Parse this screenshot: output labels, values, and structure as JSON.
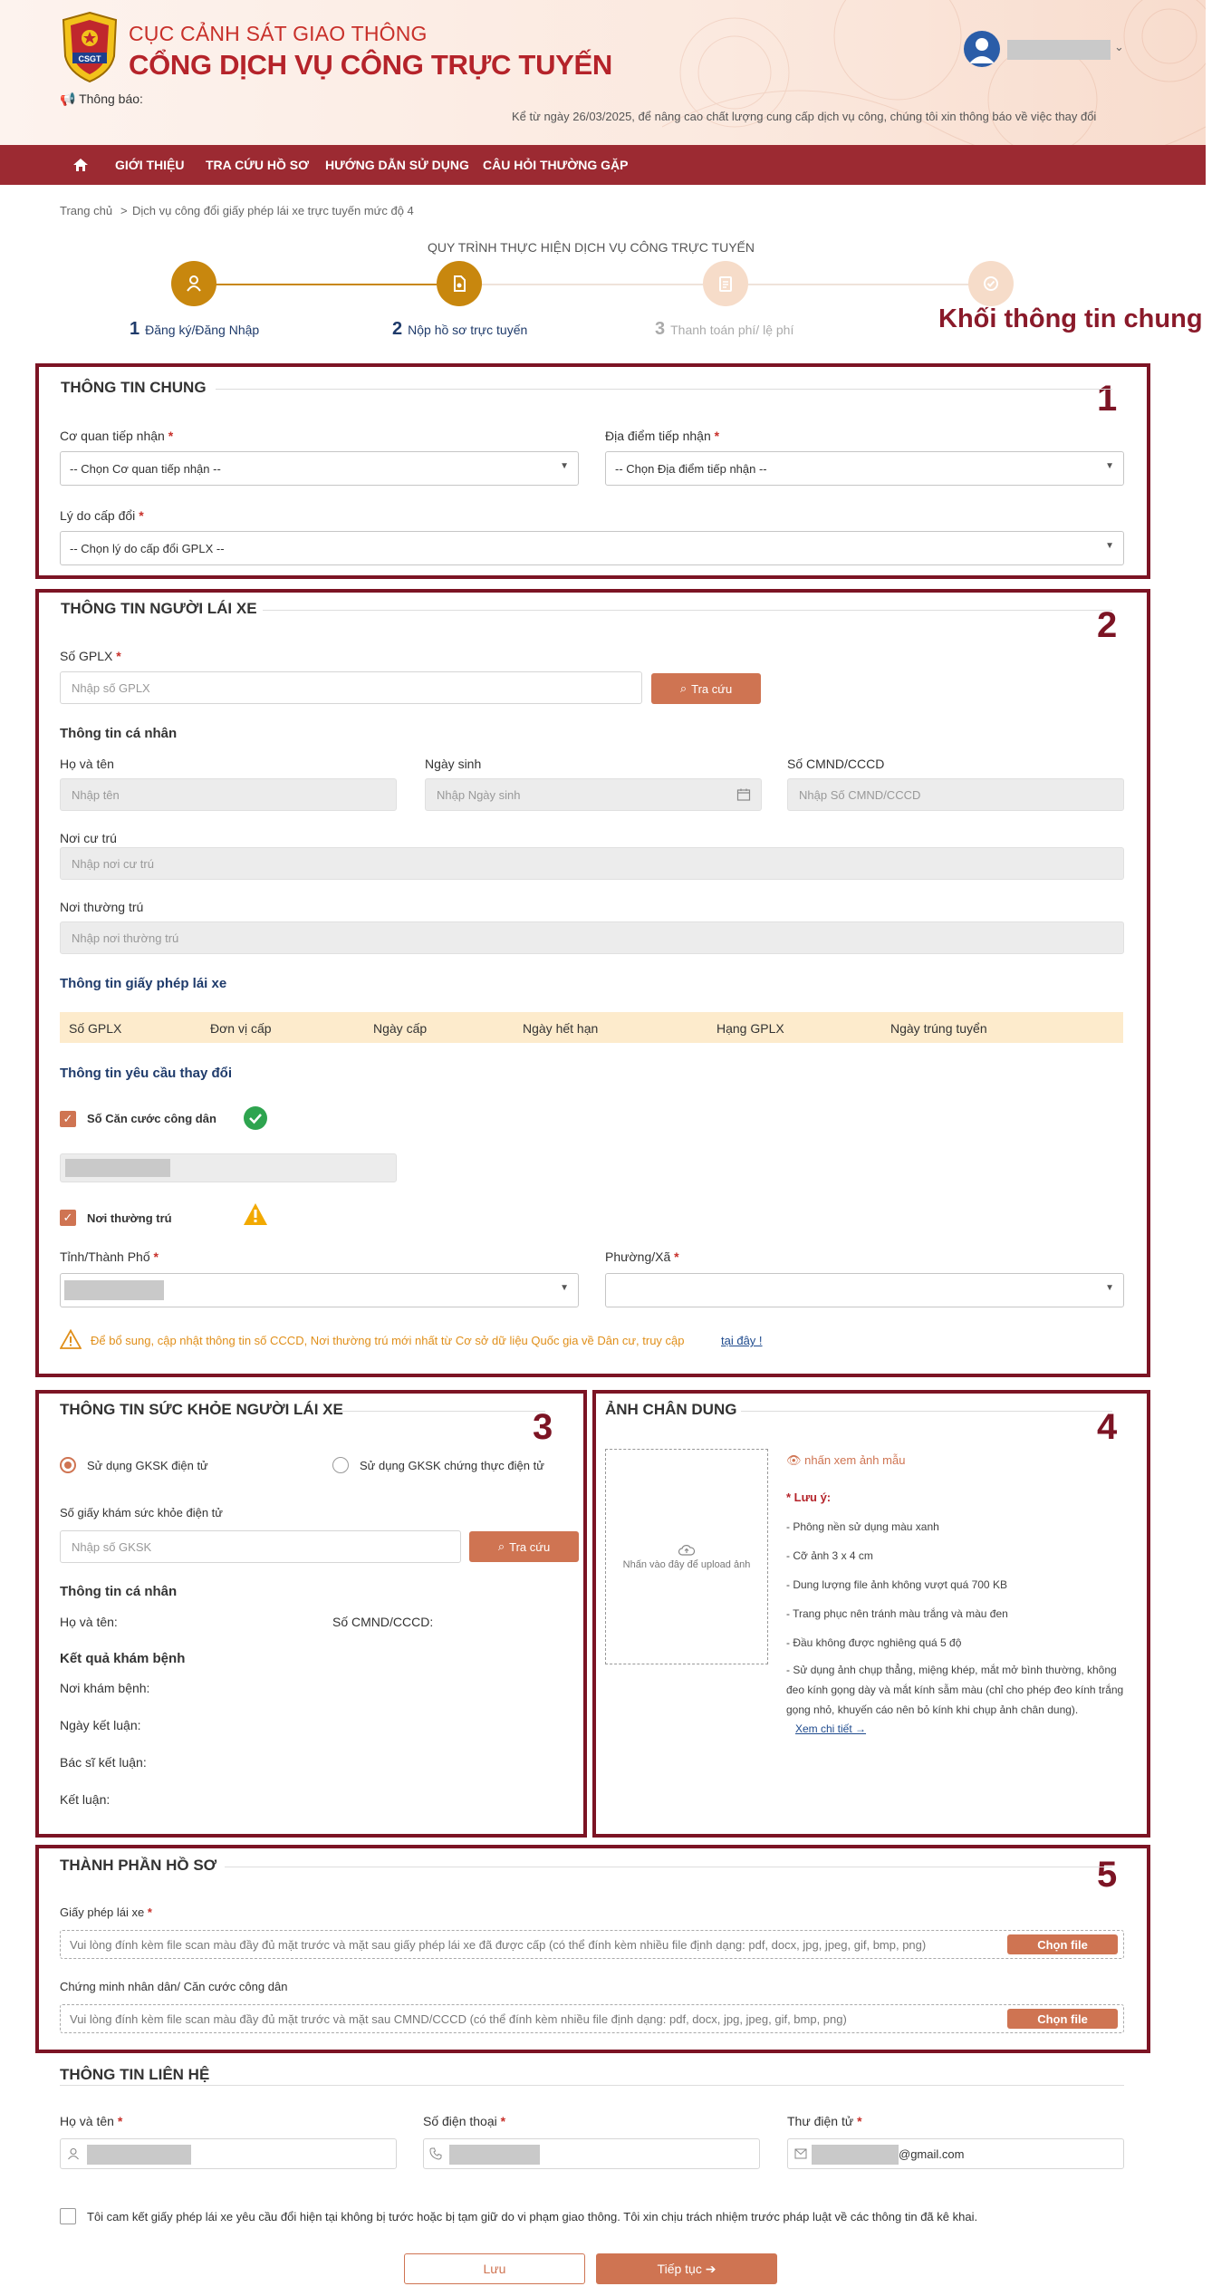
{
  "header": {
    "agency": "CỤC CẢNH SÁT GIAO THÔNG",
    "portal": "CỔNG DỊCH VỤ CÔNG TRỰC TUYẾN",
    "notice_label": "📢 Thông báo:",
    "notice_text": "Kể từ ngày 26/03/2025, để nâng cao chất lượng cung cấp dịch vụ công, chúng tôi xin thông báo về việc thay đổi",
    "logo_text": "CSGT",
    "user_caret": "⌄"
  },
  "nav": {
    "items": [
      "GIỚI THIỆU",
      "TRA CỨU HỒ SƠ",
      "HƯỚNG DẪN SỬ DỤNG",
      "CÂU HỎI THƯỜNG GẶP"
    ]
  },
  "breadcrumb": {
    "home": "Trang chủ",
    "sep": ">",
    "current": "Dịch vụ công đổi giấy phép lái xe trực tuyến mức độ 4"
  },
  "steps": {
    "title": "QUY TRÌNH THỰC HIỆN DỊCH VỤ CÔNG TRỰC TUYẾN",
    "items": [
      {
        "num": "1",
        "label": "Đăng ký/Đăng Nhập"
      },
      {
        "num": "2",
        "label": "Nộp hồ sơ trực tuyến"
      },
      {
        "num": "3",
        "label": "Thanh toán phí/ lệ phí"
      }
    ],
    "active_color": "#c8870e",
    "inactive_color": "#f6dcc9"
  },
  "annotations": {
    "title": "Khối thông tin chung",
    "n1": "1",
    "n2": "2",
    "n3": "3",
    "n4": "4",
    "n5": "5"
  },
  "general": {
    "title": "THÔNG TIN CHUNG",
    "agency_label": "Cơ quan tiếp nhận",
    "agency_value": "-- Chọn Cơ quan tiếp nhận --",
    "place_label": "Địa điểm tiếp nhận",
    "place_value": "-- Chọn Địa điểm tiếp nhận --",
    "reason_label": "Lý do cấp đổi",
    "reason_value": "-- Chọn lý do cấp đổi GPLX --",
    "star": "*"
  },
  "driver": {
    "title": "THÔNG TIN NGƯỜI LÁI XE",
    "gplx_label": "Số GPLX",
    "gplx_placeholder": "Nhập số GPLX",
    "lookup": "Tra cứu",
    "personal_title": "Thông tin cá nhân",
    "name_label": "Họ và tên",
    "name_placeholder": "Nhập tên",
    "dob_label": "Ngày sinh",
    "dob_placeholder": "Nhập Ngày sinh",
    "id_label": "Số CMND/CCCD",
    "id_placeholder": "Nhập Số CMND/CCCD",
    "residence_label": "Nơi cư trú",
    "residence_placeholder": "Nhập nơi cư trú",
    "permanent_label": "Nơi thường trú",
    "permanent_placeholder": "Nhập nơi thường trú",
    "license_title": "Thông tin giấy phép lái xe",
    "columns": [
      "Số GPLX",
      "Đơn vị cấp",
      "Ngày cấp",
      "Ngày hết hạn",
      "Hạng GPLX",
      "Ngày trúng tuyển"
    ],
    "change_title": "Thông tin yêu cầu thay đổi",
    "cccd_check": "Số Căn cước công dân",
    "permanent_check": "Nơi thường trú",
    "province_label": "Tỉnh/Thành Phố",
    "ward_label": "Phường/Xã",
    "warning_text": "Để bổ sung, cập nhật thông tin số CCCD, Nơi thường trú mới nhất từ Cơ sở dữ liệu Quốc gia về Dân cư, truy cập",
    "warning_link": "tại đây !"
  },
  "health": {
    "title": "THÔNG TIN SỨC KHỎE NGƯỜI LÁI XE",
    "opt1": "Sử dụng GKSK điện tử",
    "opt2": "Sử dụng GKSK chứng thực điện tử",
    "cert_label": "Số giấy khám sức khỏe điện tử",
    "cert_placeholder": "Nhập số GKSK",
    "lookup": "Tra cứu",
    "personal_title": "Thông tin cá nhân",
    "name": "Họ và tên:",
    "id": "Số CMND/CCCD:",
    "result_title": "Kết quả khám bệnh",
    "place": "Nơi khám bệnh:",
    "date": "Ngày kết luận:",
    "doctor": "Bác sĩ kết luận:",
    "conclusion": "Kết luận:"
  },
  "portrait": {
    "title": "ẢNH CHÂN DUNG",
    "upload_hint": "Nhấn vào đây để upload ảnh",
    "sample_link": "nhấn xem ảnh mẫu",
    "note_title": "* Lưu ý:",
    "notes": [
      "- Phông nền sử dụng màu xanh",
      "- Cỡ ảnh 3 x 4 cm",
      "- Dung lượng file ảnh không vượt quá 700 KB",
      "- Trang phục nên tránh màu trắng và màu đen",
      "- Đầu không được nghiêng quá 5 độ",
      "- Sử dụng ảnh chụp thẳng, miệng khép, mắt mở bình thường, không đeo kính gọng dày và mắt kính sẫm màu (chỉ cho phép đeo kính trắng gọng nhỏ, khuyến cáo nên bỏ kính khi chụp ảnh chân dung)."
    ],
    "detail_link": "Xem chi tiết →"
  },
  "documents": {
    "title": "THÀNH PHẦN HỒ SƠ",
    "license_label": "Giấy phép lái xe",
    "license_hint": "Vui lòng đính kèm file scan màu đầy đủ mặt trước và mặt sau giấy phép lái xe đã được cấp (có thể đính kèm nhiều file định dạng: pdf, docx, jpg, jpeg, gif, bmp, png)",
    "id_label": "Chứng minh nhân dân/ Căn cước công dân",
    "id_hint": "Vui lòng đính kèm file scan màu đầy đủ mặt trước và mặt sau CMND/CCCD (có thể đính kèm nhiều file định dạng: pdf, docx, jpg, jpeg, gif, bmp, png)",
    "choose_file": "Chọn file"
  },
  "contact": {
    "title": "THÔNG TIN LIÊN HỆ",
    "name_label": "Họ và tên",
    "phone_label": "Số điện thoại",
    "email_label": "Thư điện tử",
    "email_suffix": "@gmail.com"
  },
  "commit": {
    "text": "Tôi cam kết giấy phép lái xe yêu cầu đổi hiện tại không bị tước hoặc bị tạm giữ do vi phạm giao thông. Tôi xin chịu trách nhiệm trước pháp luật về các thông tin đã kê khai."
  },
  "actions": {
    "save": "Lưu",
    "next": "Tiếp tục ➔"
  },
  "colors": {
    "brand_red": "#9c2a32",
    "accent_orange": "#cf7452",
    "annotation_border": "#7c1424"
  }
}
